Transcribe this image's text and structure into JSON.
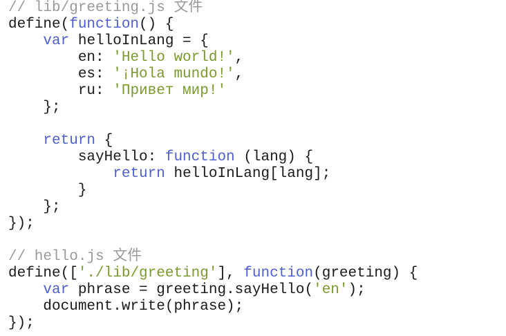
{
  "editor": {
    "colors": {
      "background": "#ffffff",
      "plain": "#1a1a1a",
      "keyword": "#4d5fd1",
      "string": "#7a9a2e",
      "comment": "#9a9a9a"
    },
    "lines": [
      [
        {
          "t": "// lib/greeting.js 文件",
          "c": "comment"
        }
      ],
      [
        {
          "t": "define(",
          "c": "plain"
        },
        {
          "t": "function",
          "c": "keyword"
        },
        {
          "t": "() {",
          "c": "plain"
        }
      ],
      [
        {
          "t": "    ",
          "c": "plain"
        },
        {
          "t": "var",
          "c": "keyword"
        },
        {
          "t": " helloInLang = {",
          "c": "plain"
        }
      ],
      [
        {
          "t": "        en: ",
          "c": "plain"
        },
        {
          "t": "'Hello world!'",
          "c": "string"
        },
        {
          "t": ",",
          "c": "plain"
        }
      ],
      [
        {
          "t": "        es: ",
          "c": "plain"
        },
        {
          "t": "'¡Hola mundo!'",
          "c": "string"
        },
        {
          "t": ",",
          "c": "plain"
        }
      ],
      [
        {
          "t": "        ru: ",
          "c": "plain"
        },
        {
          "t": "'Привет мир!'",
          "c": "string"
        }
      ],
      [
        {
          "t": "    };",
          "c": "plain"
        }
      ],
      [],
      [
        {
          "t": "    ",
          "c": "plain"
        },
        {
          "t": "return",
          "c": "keyword"
        },
        {
          "t": " {",
          "c": "plain"
        }
      ],
      [
        {
          "t": "        sayHello: ",
          "c": "plain"
        },
        {
          "t": "function",
          "c": "keyword"
        },
        {
          "t": " (lang) {",
          "c": "plain"
        }
      ],
      [
        {
          "t": "            ",
          "c": "plain"
        },
        {
          "t": "return",
          "c": "keyword"
        },
        {
          "t": " helloInLang[lang];",
          "c": "plain"
        }
      ],
      [
        {
          "t": "        }",
          "c": "plain"
        }
      ],
      [
        {
          "t": "    };",
          "c": "plain"
        }
      ],
      [
        {
          "t": "});",
          "c": "plain"
        }
      ],
      [],
      [
        {
          "t": "// hello.js 文件",
          "c": "comment"
        }
      ],
      [
        {
          "t": "define([",
          "c": "plain"
        },
        {
          "t": "'./lib/greeting'",
          "c": "string"
        },
        {
          "t": "], ",
          "c": "plain"
        },
        {
          "t": "function",
          "c": "keyword"
        },
        {
          "t": "(greeting) {",
          "c": "plain"
        }
      ],
      [
        {
          "t": "    ",
          "c": "plain"
        },
        {
          "t": "var",
          "c": "keyword"
        },
        {
          "t": " phrase = greeting.sayHello(",
          "c": "plain"
        },
        {
          "t": "'en'",
          "c": "string"
        },
        {
          "t": ");",
          "c": "plain"
        }
      ],
      [
        {
          "t": "    document.write(phrase);",
          "c": "plain"
        }
      ],
      [
        {
          "t": "});",
          "c": "plain"
        }
      ]
    ]
  }
}
